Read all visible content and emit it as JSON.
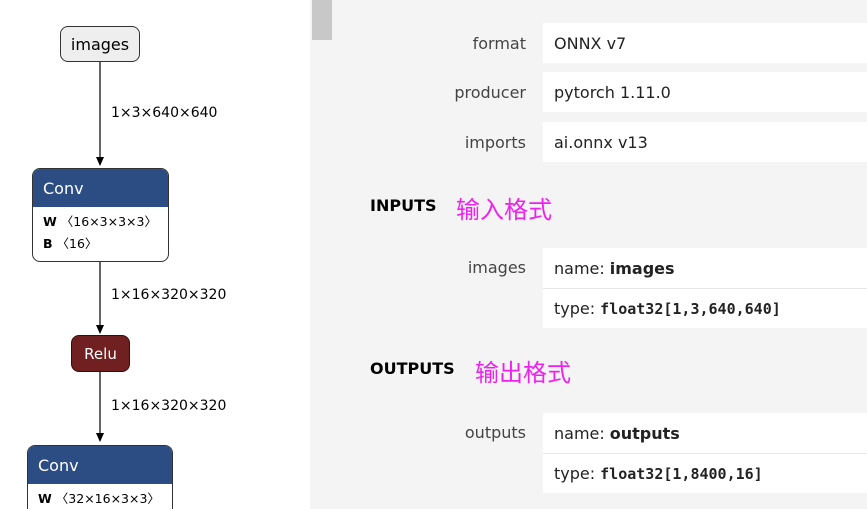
{
  "graph": {
    "input_node": {
      "label": "images"
    },
    "edges": [
      {
        "label": "1×3×640×640"
      },
      {
        "label": "1×16×320×320"
      },
      {
        "label": "1×16×320×320"
      }
    ],
    "conv1": {
      "label": "Conv",
      "attrs": [
        {
          "key": "W",
          "value": "〈16×3×3×3〉"
        },
        {
          "key": "B",
          "value": "〈16〉"
        }
      ]
    },
    "relu": {
      "label": "Relu"
    },
    "conv2": {
      "label": "Conv",
      "attrs": [
        {
          "key": "W",
          "value": "〈32×16×3×3〉"
        }
      ]
    },
    "colors": {
      "conv": "#2c4d83",
      "relu": "#702020",
      "input": "#eeeeee"
    }
  },
  "properties": {
    "format": {
      "label": "format",
      "value": "ONNX v7"
    },
    "producer": {
      "label": "producer",
      "value": "pytorch 1.11.0"
    },
    "imports": {
      "label": "imports",
      "value": "ai.onnx v13"
    }
  },
  "inputs": {
    "title": "INPUTS",
    "note": "输入格式",
    "items": [
      {
        "label": "images",
        "name_key": "name:",
        "name": "images",
        "type_key": "type:",
        "type": "float32[1,3,640,640]"
      }
    ]
  },
  "outputs": {
    "title": "OUTPUTS",
    "note": "输出格式",
    "items": [
      {
        "label": "outputs",
        "name_key": "name:",
        "name": "outputs",
        "type_key": "type:",
        "type": "float32[1,8400,16]"
      }
    ]
  },
  "annotation_color": "#ee22ee"
}
